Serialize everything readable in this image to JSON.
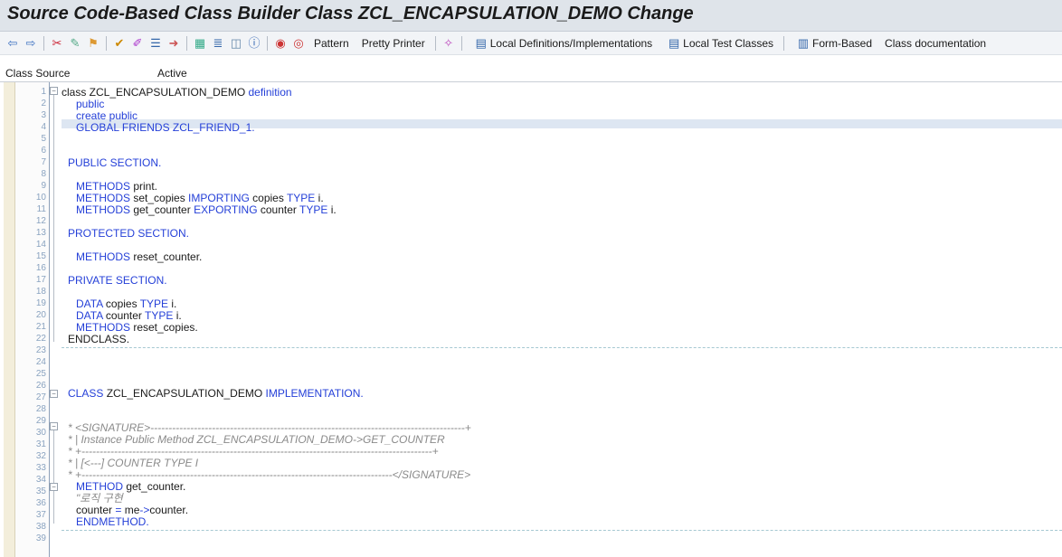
{
  "title": "Source Code-Based Class Builder Class ZCL_ENCAPSULATION_DEMO Change",
  "toolbar": {
    "icons": [
      "back-arrow-icon",
      "forward-arrow-icon",
      "other-object-icon",
      "display-change-icon",
      "activate-icon",
      "check-icon",
      "where-used-icon",
      "pencil-icon",
      "object-list-icon",
      "navigate-icon",
      "hierarchy-icon",
      "constructor-icon",
      "split-icon",
      "info-icon",
      "breakpoint-icon",
      "session-breakpoint-icon"
    ],
    "pattern": "Pattern",
    "pretty_printer": "Pretty Printer",
    "local_defs": "Local Definitions/Implementations",
    "local_tests": "Local Test Classes",
    "form_based": "Form-Based",
    "class_doc": "Class documentation"
  },
  "status": {
    "label": "Class Source",
    "value": "Active"
  },
  "lines": [
    {
      "n": "1"
    },
    {
      "n": "2"
    },
    {
      "n": "3"
    },
    {
      "n": "4"
    },
    {
      "n": "5"
    },
    {
      "n": "6"
    },
    {
      "n": "7"
    },
    {
      "n": "8"
    },
    {
      "n": "9"
    },
    {
      "n": "10"
    },
    {
      "n": "11"
    },
    {
      "n": "12"
    },
    {
      "n": "13"
    },
    {
      "n": "14"
    },
    {
      "n": "15"
    },
    {
      "n": "16"
    },
    {
      "n": "17"
    },
    {
      "n": "18"
    },
    {
      "n": "19"
    },
    {
      "n": "20"
    },
    {
      "n": "21"
    },
    {
      "n": "22"
    },
    {
      "n": "23"
    },
    {
      "n": "24"
    },
    {
      "n": "25"
    },
    {
      "n": "26"
    },
    {
      "n": "27"
    },
    {
      "n": "28"
    },
    {
      "n": "29"
    },
    {
      "n": "30"
    },
    {
      "n": "31"
    },
    {
      "n": "32"
    },
    {
      "n": "33"
    },
    {
      "n": "34"
    },
    {
      "n": "35"
    },
    {
      "n": "36"
    },
    {
      "n": "37"
    },
    {
      "n": "38"
    },
    {
      "n": "39"
    }
  ],
  "code": {
    "l1a": "class",
    "l1b": " ZCL_ENCAPSULATION_DEMO ",
    "l1c": "definition",
    "l2": "public",
    "l3": "create public",
    "l4": "GLOBAL FRIENDS ZCL_FRIEND_1.",
    "l7": "PUBLIC SECTION.",
    "l9a": "METHODS",
    "l9b": " print.",
    "l10a": "METHODS",
    "l10b": " set_copies ",
    "l10c": "IMPORTING",
    "l10d": " copies ",
    "l10e": "TYPE",
    "l10f": " i.",
    "l11a": "METHODS",
    "l11b": " get_counter ",
    "l11c": "EXPORTING",
    "l11d": " counter ",
    "l11e": "TYPE",
    "l11f": " i.",
    "l13": "PROTECTED SECTION.",
    "l15a": "METHODS",
    "l15b": " reset_counter.",
    "l17": "PRIVATE SECTION.",
    "l19a": "DATA",
    "l19b": " copies ",
    "l19c": "TYPE",
    "l19d": " i.",
    "l20a": "DATA",
    "l20b": " counter ",
    "l20c": "TYPE",
    "l20d": " i.",
    "l21a": "METHODS",
    "l21b": " reset_copies.",
    "l22": "ENDCLASS.",
    "l26a": "CLASS",
    "l26b": " ZCL_ENCAPSULATION_DEMO ",
    "l26c": "IMPLEMENTATION.",
    "l29": "* <SIGNATURE>---------------------------------------------------------------------------------------+",
    "l30": "* | Instance Public Method ZCL_ENCAPSULATION_DEMO->GET_COUNTER",
    "l31": "* +-------------------------------------------------------------------------------------------------+",
    "l32": "* | [<---] COUNTER                    TYPE        I",
    "l33": "* +--------------------------------------------------------------------------------------</SIGNATURE>",
    "l34a": "METHOD",
    "l34b": " get_counter.",
    "l35": "\"로직 구현",
    "l36a": "counter ",
    "l36b": "=",
    "l36c": " me",
    "l36d": "->",
    "l36e": "counter.",
    "l37": "ENDMETHOD."
  }
}
